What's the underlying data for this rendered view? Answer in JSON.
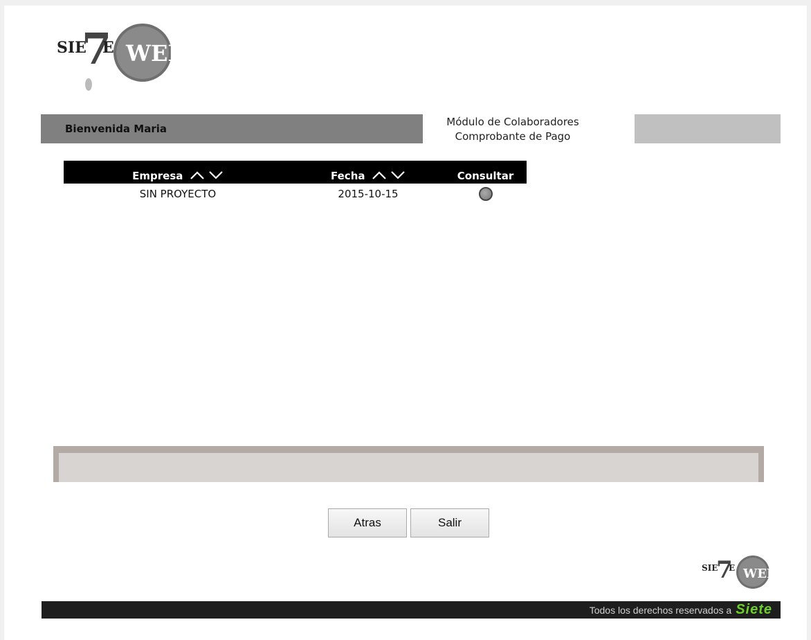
{
  "logo": {
    "text_left": "SIE",
    "text_seven": "7",
    "text_e": "E",
    "text_web": "WEB"
  },
  "header": {
    "welcome": "Bienvenida Maria",
    "module_line1": "Módulo de Colaboradores",
    "module_line2": "Comprobante de Pago"
  },
  "table": {
    "headers": {
      "empresa": "Empresa",
      "fecha": "Fecha",
      "consultar": "Consultar"
    },
    "rows": [
      {
        "empresa": "SIN PROYECTO",
        "fecha": "2015-10-15"
      }
    ]
  },
  "buttons": {
    "back": "Atras",
    "exit": "Salir"
  },
  "footer": {
    "text": "Todos los derechos reservados a",
    "brand": "Siete"
  },
  "colors": {
    "welcome_bar": "#808080",
    "right_bar": "#c0c0c0",
    "footer_bg": "#1e1e1e",
    "brand_green": "#6ccf2a"
  },
  "icons": [
    "sort-asc-icon",
    "sort-desc-icon",
    "radio-select-icon"
  ]
}
